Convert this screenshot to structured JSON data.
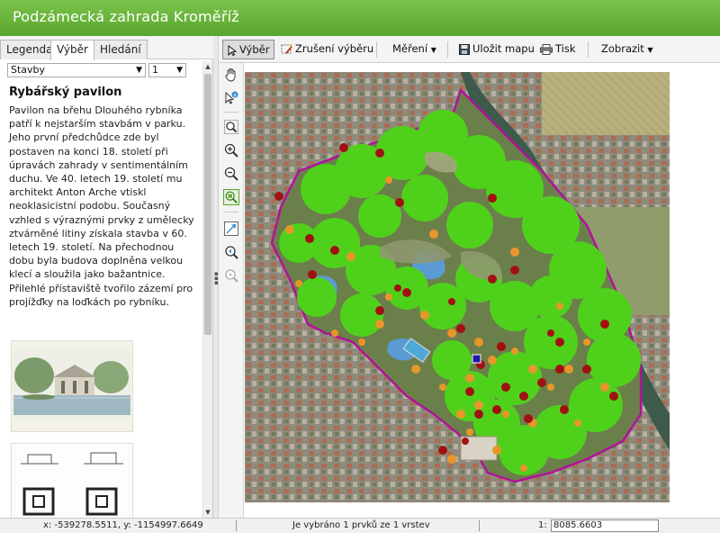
{
  "app": {
    "title": "Podzámecká zahrada Kroměříž",
    "header_color": "#62ad37"
  },
  "left_panel": {
    "tabs": [
      {
        "label": "Legenda",
        "active": false
      },
      {
        "label": "Výběr",
        "active": true
      },
      {
        "label": "Hledání",
        "active": false
      }
    ],
    "layer_select": {
      "value": "Stavby"
    },
    "index_select": {
      "value": "1"
    },
    "feature_title": "Rybářský pavilon",
    "feature_description": "Pavilon na břehu Dlouhého rybníka patří k nejstarším stavbám v parku. Jeho první předchůdce zde byl postaven na konci 18. století při úpravách zahrady v sentimentálním duchu. Ve 40. letech 19. století mu architekt Anton Arche vtiskl neoklasicistní podobu. Současný vzhled s výraznými prvky z umělecky ztvárněné litiny získala stavba v 60. letech 19. století. Na přechodnou dobu byla budova doplněna velkou klecí a sloužila jako bažantnice. Přilehlé přístaviště tvořilo zázemí pro projížďky na loďkách po rybníku."
  },
  "toolbar": {
    "select_label": "Výběr",
    "clear_selection_label": "Zrušení výběru",
    "measure_label": "Měření",
    "save_map_label": "Uložit mapu",
    "print_label": "Tisk",
    "view_label": "Zobrazit"
  },
  "tools": [
    {
      "icon": "pan-icon"
    },
    {
      "icon": "identify-icon"
    },
    {
      "icon": "zoom-box-icon"
    },
    {
      "icon": "zoom-in-icon"
    },
    {
      "icon": "zoom-out-icon"
    },
    {
      "icon": "zoom-selection-icon"
    },
    {
      "icon": "full-extent-icon"
    },
    {
      "icon": "previous-extent-icon"
    },
    {
      "icon": "next-extent-icon"
    }
  ],
  "status_bar": {
    "coordinates": "x: -539278.5511, y: -1154997.6649",
    "selection_message": "Je vybráno 1 prvků ze 1 vrstev",
    "scale_prefix": "1:",
    "scale_value": "8085.6603"
  },
  "colors": {
    "tree_green": "#4fd11c",
    "tree_orange": "#e8962a",
    "tree_red": "#a11111",
    "park_boundary": "#b1129b",
    "pond_blue": "#5a9bd4",
    "selected_feature": "#1a1aa8"
  }
}
